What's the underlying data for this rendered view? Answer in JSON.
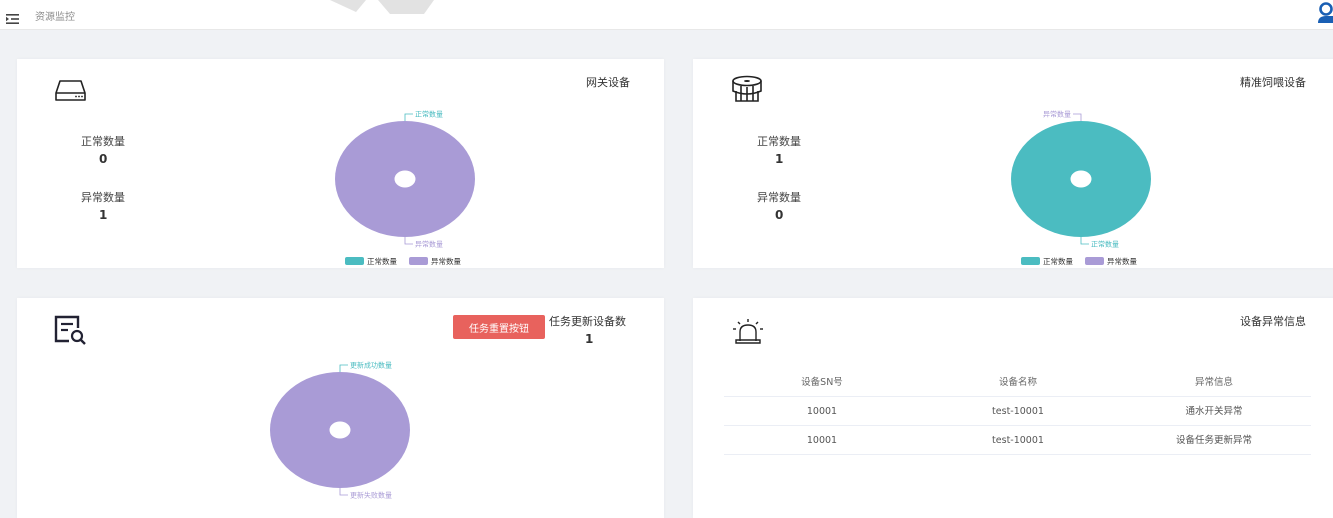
{
  "header": {
    "breadcrumb": "资源监控",
    "menu_icon": "menu-fold-icon",
    "user_icon": "user-icon"
  },
  "colors": {
    "normal": "#4bbcc1",
    "abnormal": "#a99bd6",
    "button": "#e8625d",
    "icon": "#1a5fb4"
  },
  "gateway": {
    "title": "网关设备",
    "icon": "gateway-device-icon",
    "normal_label": "正常数量",
    "normal_value": "0",
    "abnormal_label": "异常数量",
    "abnormal_value": "1"
  },
  "feeder": {
    "title": "精准饲喂设备",
    "icon": "feeder-device-icon",
    "normal_label": "正常数量",
    "normal_value": "1",
    "abnormal_label": "异常数量",
    "abnormal_value": "0"
  },
  "task": {
    "title": "任务更新设备数",
    "value": "1",
    "reset_button": "任务重置按钮",
    "icon": "document-search-icon"
  },
  "alerts": {
    "title": "设备异常信息",
    "icon": "alarm-icon",
    "columns": [
      "设备SN号",
      "设备名称",
      "异常信息"
    ],
    "rows": [
      [
        "10001",
        "test-10001",
        "通水开关异常"
      ],
      [
        "10001",
        "test-10001",
        "设备任务更新异常"
      ]
    ]
  },
  "chart_data": [
    {
      "type": "pie",
      "categories": [
        "正常数量",
        "异常数量"
      ],
      "values": [
        0,
        1
      ],
      "colors": [
        "#4bbcc1",
        "#a99bd6"
      ],
      "legend": "bottom"
    },
    {
      "type": "pie",
      "categories": [
        "正常数量",
        "异常数量"
      ],
      "values": [
        1,
        0
      ],
      "colors": [
        "#4bbcc1",
        "#a99bd6"
      ],
      "legend": "bottom"
    },
    {
      "type": "pie",
      "categories": [
        "更新成功数量",
        "更新失败数量"
      ],
      "values": [
        0,
        1
      ],
      "colors": [
        "#4bbcc1",
        "#a99bd6"
      ],
      "legend": "none"
    }
  ]
}
